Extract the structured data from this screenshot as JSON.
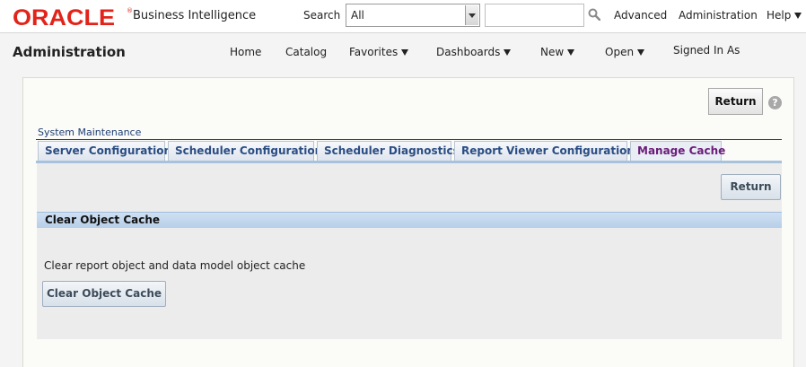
{
  "header": {
    "logo": "ORACLE",
    "logo_mark": "®",
    "product": "Business Intelligence",
    "search_label": "Search",
    "search_scope": "All",
    "search_query": "",
    "links": {
      "advanced": "Advanced",
      "administration": "Administration",
      "help": "Help"
    }
  },
  "navbar": {
    "page_title": "Administration",
    "links": {
      "home": "Home",
      "catalog": "Catalog",
      "favorites": "Favorites",
      "dashboards": "Dashboards",
      "new": "New",
      "open": "Open",
      "signed_in": "Signed In As"
    }
  },
  "panel": {
    "return_top": "Return",
    "help_icon": "?",
    "section_title": "System Maintenance",
    "tabs": [
      {
        "label": "Server Configuration"
      },
      {
        "label": "Scheduler Configuration"
      },
      {
        "label": "Scheduler Diagnostics"
      },
      {
        "label": "Report Viewer Configuration"
      },
      {
        "label": "Manage Cache"
      }
    ],
    "active_tab": "Manage Cache",
    "return_button": "Return",
    "cache_section": {
      "header": "Clear Object Cache",
      "description": "Clear report object and data model object cache",
      "button": "Clear Object Cache"
    }
  },
  "colors": {
    "oracle_red": "#e2231a",
    "tab_text": "#2a4d83",
    "active_tab_text": "#6b1b7a",
    "section_header": "#b7cfe8"
  },
  "icons": [
    "search-icon",
    "dropdown-arrow-icon",
    "caret-down-icon",
    "help-icon"
  ]
}
